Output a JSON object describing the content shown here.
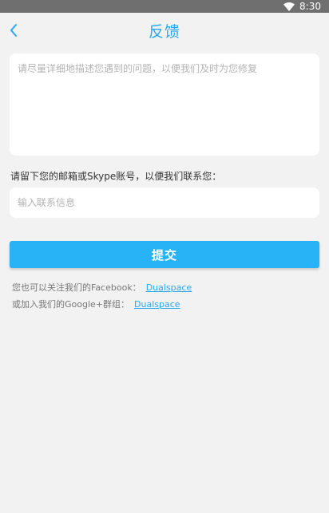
{
  "status_bar": {
    "time": "8:30",
    "wifi_icon": "wifi-icon"
  },
  "header": {
    "back_icon": "chevron-left-icon",
    "title": "反馈"
  },
  "form": {
    "description_placeholder": "请尽量详细地描述您遇到的问题，以便我们及时为您修复",
    "contact_label": "请留下您的邮箱或Skype账号，以便我们联系您：",
    "contact_placeholder": "输入联系信息",
    "submit_label": "提交"
  },
  "follow": {
    "facebook_text": "您也可以关注我们的Facebook：",
    "facebook_link": "Dualspace",
    "google_text": "或加入我们的Google+群组：",
    "google_link": "Dualspace"
  },
  "colors": {
    "accent": "#29a8f2",
    "button": "#29b3f7",
    "background": "#f2f2f2",
    "status_bar": "#6f6f6f"
  }
}
